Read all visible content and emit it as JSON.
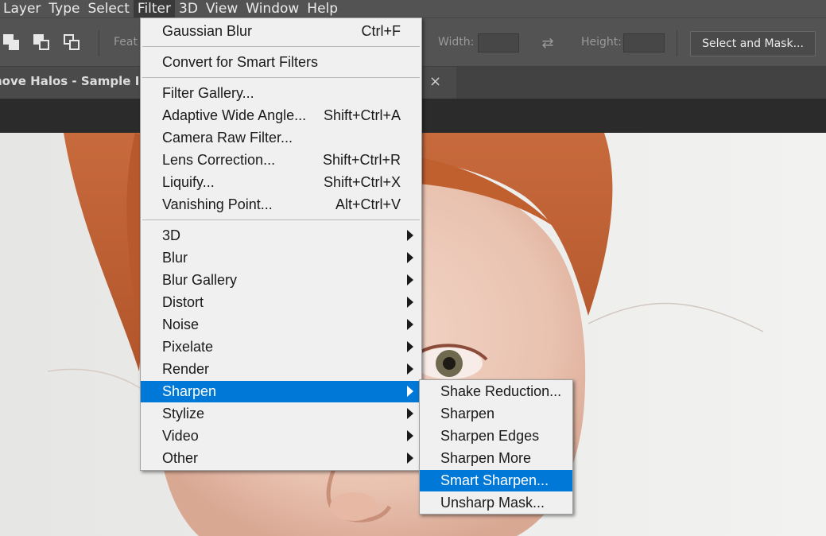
{
  "menubar": {
    "items": [
      "Layer",
      "Type",
      "Select",
      "Filter",
      "3D",
      "View",
      "Window",
      "Help"
    ],
    "active": "Filter"
  },
  "options_bar": {
    "feather_label": "Feat",
    "width_label": "Width:",
    "height_label": "Height:",
    "select_mask_label": "Select and Mask..."
  },
  "document": {
    "tab_title": "nove Halos - Sample Im",
    "close_glyph": "×"
  },
  "filter_menu": {
    "groups": [
      [
        {
          "label": "Gaussian Blur",
          "shortcut": "Ctrl+F"
        }
      ],
      [
        {
          "label": "Convert for Smart Filters",
          "shortcut": ""
        }
      ],
      [
        {
          "label": "Filter Gallery...",
          "shortcut": ""
        },
        {
          "label": "Adaptive Wide Angle...",
          "shortcut": "Shift+Ctrl+A"
        },
        {
          "label": "Camera Raw Filter...",
          "shortcut": ""
        },
        {
          "label": "Lens Correction...",
          "shortcut": "Shift+Ctrl+R"
        },
        {
          "label": "Liquify...",
          "shortcut": "Shift+Ctrl+X"
        },
        {
          "label": "Vanishing Point...",
          "shortcut": "Alt+Ctrl+V"
        }
      ],
      [
        {
          "label": "3D",
          "submenu": true
        },
        {
          "label": "Blur",
          "submenu": true
        },
        {
          "label": "Blur Gallery",
          "submenu": true
        },
        {
          "label": "Distort",
          "submenu": true
        },
        {
          "label": "Noise",
          "submenu": true
        },
        {
          "label": "Pixelate",
          "submenu": true
        },
        {
          "label": "Render",
          "submenu": true
        },
        {
          "label": "Sharpen",
          "submenu": true,
          "highlighted": true
        },
        {
          "label": "Stylize",
          "submenu": true
        },
        {
          "label": "Video",
          "submenu": true
        },
        {
          "label": "Other",
          "submenu": true
        }
      ]
    ]
  },
  "sharpen_submenu": {
    "items": [
      {
        "label": "Shake Reduction..."
      },
      {
        "label": "Sharpen"
      },
      {
        "label": "Sharpen Edges"
      },
      {
        "label": "Sharpen More"
      },
      {
        "label": "Smart Sharpen...",
        "highlighted": true
      },
      {
        "label": "Unsharp Mask..."
      }
    ]
  },
  "colors": {
    "highlight": "#0078d7",
    "menu_bg": "#f0f0f0",
    "chrome": "#535353"
  }
}
